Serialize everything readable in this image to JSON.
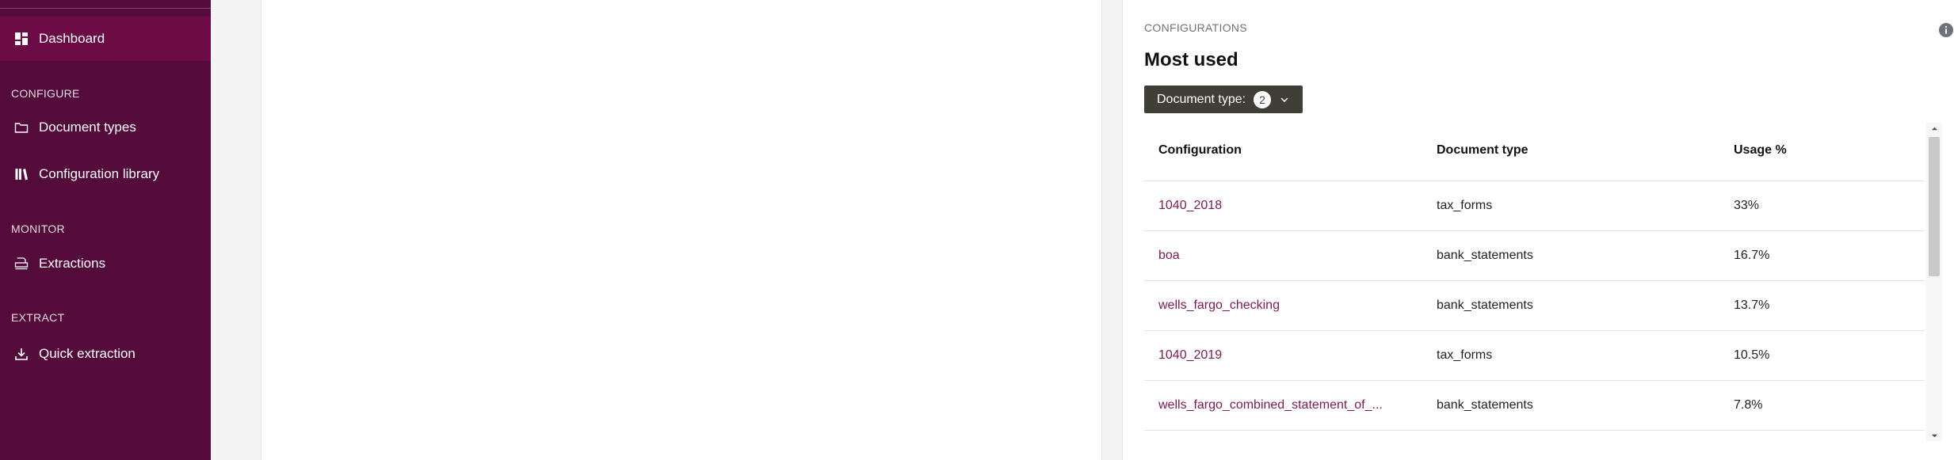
{
  "sidebar": {
    "dashboard": "Dashboard",
    "sections": {
      "configure": "CONFIGURE",
      "monitor": "MONITOR",
      "extract": "EXTRACT"
    },
    "items": {
      "document_types": "Document types",
      "configuration_library": "Configuration library",
      "extractions": "Extractions",
      "quick_extraction": "Quick extraction"
    },
    "colors": {
      "background": "#540a3a",
      "active": "#6b0a45"
    }
  },
  "config_panel": {
    "kicker": "CONFIGURATIONS",
    "title": "Most used",
    "filter": {
      "label": "Document type:",
      "count": "2"
    },
    "columns": {
      "configuration": "Configuration",
      "document_type": "Document type",
      "usage": "Usage %"
    },
    "rows": [
      {
        "configuration": "1040_2018",
        "document_type": "tax_forms",
        "usage": "33%"
      },
      {
        "configuration": "boa",
        "document_type": "bank_statements",
        "usage": "16.7%"
      },
      {
        "configuration": "wells_fargo_checking",
        "document_type": "bank_statements",
        "usage": "13.7%"
      },
      {
        "configuration": "1040_2019",
        "document_type": "tax_forms",
        "usage": "10.5%"
      },
      {
        "configuration": "wells_fargo_combined_statement_of_...",
        "document_type": "bank_statements",
        "usage": "7.8%"
      }
    ],
    "link_color": "#7a1a55"
  }
}
